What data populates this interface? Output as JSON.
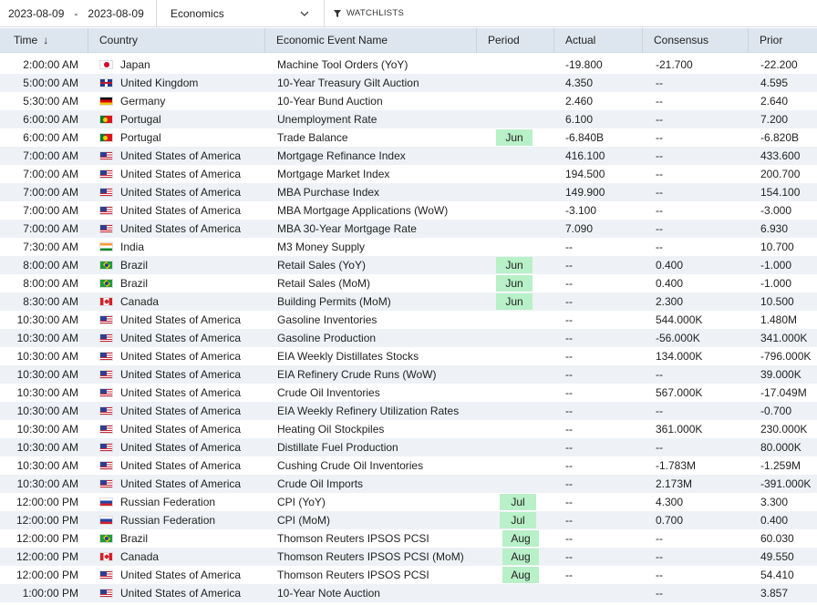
{
  "toolbar": {
    "date_from": "2023-08-09",
    "date_sep": "-",
    "date_to": "2023-08-09",
    "category": "Economics",
    "watchlists_label": "WATCHLISTS"
  },
  "columns": {
    "time": "Time",
    "country": "Country",
    "event": "Economic Event Name",
    "period": "Period",
    "actual": "Actual",
    "consensus": "Consensus",
    "prior": "Prior"
  },
  "sort_icon": "arrow-down-icon",
  "colors": {
    "header_bg": "#dde6ee",
    "stripe": "#eef2f6",
    "period_pill": "#b8f0c8"
  },
  "rows": [
    {
      "time": "2:00:00 AM",
      "flag": "jp",
      "country": "Japan",
      "event": "Machine Tool Orders (YoY)",
      "period": "",
      "actual": "-19.800",
      "consensus": "-21.700",
      "prior": "-22.200"
    },
    {
      "time": "5:00:00 AM",
      "flag": "uk",
      "country": "United Kingdom",
      "event": "10-Year Treasury Gilt Auction",
      "period": "",
      "actual": "4.350",
      "consensus": "--",
      "prior": "4.595"
    },
    {
      "time": "5:30:00 AM",
      "flag": "de",
      "country": "Germany",
      "event": "10-Year Bund Auction",
      "period": "",
      "actual": "2.460",
      "consensus": "--",
      "prior": "2.640"
    },
    {
      "time": "6:00:00 AM",
      "flag": "pt",
      "country": "Portugal",
      "event": "Unemployment Rate",
      "period": "",
      "actual": "6.100",
      "consensus": "--",
      "prior": "7.200"
    },
    {
      "time": "6:00:00 AM",
      "flag": "pt",
      "country": "Portugal",
      "event": "Trade Balance",
      "period": "Jun",
      "actual": "-6.840B",
      "consensus": "--",
      "prior": "-6.820B"
    },
    {
      "time": "7:00:00 AM",
      "flag": "us",
      "country": "United States of America",
      "event": "Mortgage Refinance Index",
      "period": "",
      "actual": "416.100",
      "consensus": "--",
      "prior": "433.600"
    },
    {
      "time": "7:00:00 AM",
      "flag": "us",
      "country": "United States of America",
      "event": "Mortgage Market Index",
      "period": "",
      "actual": "194.500",
      "consensus": "--",
      "prior": "200.700"
    },
    {
      "time": "7:00:00 AM",
      "flag": "us",
      "country": "United States of America",
      "event": "MBA Purchase Index",
      "period": "",
      "actual": "149.900",
      "consensus": "--",
      "prior": "154.100"
    },
    {
      "time": "7:00:00 AM",
      "flag": "us",
      "country": "United States of America",
      "event": "MBA Mortgage Applications (WoW)",
      "period": "",
      "actual": "-3.100",
      "consensus": "--",
      "prior": "-3.000"
    },
    {
      "time": "7:00:00 AM",
      "flag": "us",
      "country": "United States of America",
      "event": "MBA 30-Year Mortgage Rate",
      "period": "",
      "actual": "7.090",
      "consensus": "--",
      "prior": "6.930"
    },
    {
      "time": "7:30:00 AM",
      "flag": "in",
      "country": "India",
      "event": "M3 Money Supply",
      "period": "",
      "actual": "--",
      "consensus": "--",
      "prior": "10.700"
    },
    {
      "time": "8:00:00 AM",
      "flag": "br",
      "country": "Brazil",
      "event": "Retail Sales (YoY)",
      "period": "Jun",
      "actual": "--",
      "consensus": "0.400",
      "prior": "-1.000"
    },
    {
      "time": "8:00:00 AM",
      "flag": "br",
      "country": "Brazil",
      "event": "Retail Sales (MoM)",
      "period": "Jun",
      "actual": "--",
      "consensus": "0.400",
      "prior": "-1.000"
    },
    {
      "time": "8:30:00 AM",
      "flag": "ca",
      "country": "Canada",
      "event": "Building Permits (MoM)",
      "period": "Jun",
      "actual": "--",
      "consensus": "2.300",
      "prior": "10.500"
    },
    {
      "time": "10:30:00 AM",
      "flag": "us",
      "country": "United States of America",
      "event": "Gasoline Inventories",
      "period": "",
      "actual": "--",
      "consensus": "544.000K",
      "prior": "1.480M"
    },
    {
      "time": "10:30:00 AM",
      "flag": "us",
      "country": "United States of America",
      "event": "Gasoline Production",
      "period": "",
      "actual": "--",
      "consensus": "-56.000K",
      "prior": "341.000K"
    },
    {
      "time": "10:30:00 AM",
      "flag": "us",
      "country": "United States of America",
      "event": "EIA Weekly Distillates Stocks",
      "period": "",
      "actual": "--",
      "consensus": "134.000K",
      "prior": "-796.000K"
    },
    {
      "time": "10:30:00 AM",
      "flag": "us",
      "country": "United States of America",
      "event": "EIA Refinery Crude Runs (WoW)",
      "period": "",
      "actual": "--",
      "consensus": "--",
      "prior": "39.000K"
    },
    {
      "time": "10:30:00 AM",
      "flag": "us",
      "country": "United States of America",
      "event": "Crude Oil Inventories",
      "period": "",
      "actual": "--",
      "consensus": "567.000K",
      "prior": "-17.049M"
    },
    {
      "time": "10:30:00 AM",
      "flag": "us",
      "country": "United States of America",
      "event": "EIA Weekly Refinery Utilization Rates",
      "period": "",
      "actual": "--",
      "consensus": "--",
      "prior": "-0.700"
    },
    {
      "time": "10:30:00 AM",
      "flag": "us",
      "country": "United States of America",
      "event": "Heating Oil Stockpiles",
      "period": "",
      "actual": "--",
      "consensus": "361.000K",
      "prior": "230.000K"
    },
    {
      "time": "10:30:00 AM",
      "flag": "us",
      "country": "United States of America",
      "event": "Distillate Fuel Production",
      "period": "",
      "actual": "--",
      "consensus": "--",
      "prior": "80.000K"
    },
    {
      "time": "10:30:00 AM",
      "flag": "us",
      "country": "United States of America",
      "event": "Cushing Crude Oil Inventories",
      "period": "",
      "actual": "--",
      "consensus": "-1.783M",
      "prior": "-1.259M"
    },
    {
      "time": "10:30:00 AM",
      "flag": "us",
      "country": "United States of America",
      "event": "Crude Oil Imports",
      "period": "",
      "actual": "--",
      "consensus": "2.173M",
      "prior": "-391.000K"
    },
    {
      "time": "12:00:00 PM",
      "flag": "ru",
      "country": "Russian Federation",
      "event": "CPI (YoY)",
      "period": "Jul",
      "actual": "--",
      "consensus": "4.300",
      "prior": "3.300"
    },
    {
      "time": "12:00:00 PM",
      "flag": "ru",
      "country": "Russian Federation",
      "event": "CPI (MoM)",
      "period": "Jul",
      "actual": "--",
      "consensus": "0.700",
      "prior": "0.400"
    },
    {
      "time": "12:00:00 PM",
      "flag": "br",
      "country": "Brazil",
      "event": "Thomson Reuters IPSOS PCSI",
      "period": "Aug",
      "actual": "--",
      "consensus": "--",
      "prior": "60.030"
    },
    {
      "time": "12:00:00 PM",
      "flag": "ca",
      "country": "Canada",
      "event": "Thomson Reuters IPSOS PCSI (MoM)",
      "period": "Aug",
      "actual": "--",
      "consensus": "--",
      "prior": "49.550"
    },
    {
      "time": "12:00:00 PM",
      "flag": "us",
      "country": "United States of America",
      "event": "Thomson Reuters IPSOS PCSI",
      "period": "Aug",
      "actual": "--",
      "consensus": "--",
      "prior": "54.410"
    },
    {
      "time": "1:00:00 PM",
      "flag": "us",
      "country": "United States of America",
      "event": "10-Year Note Auction",
      "period": "",
      "actual": "",
      "consensus": "--",
      "prior": "3.857"
    }
  ]
}
